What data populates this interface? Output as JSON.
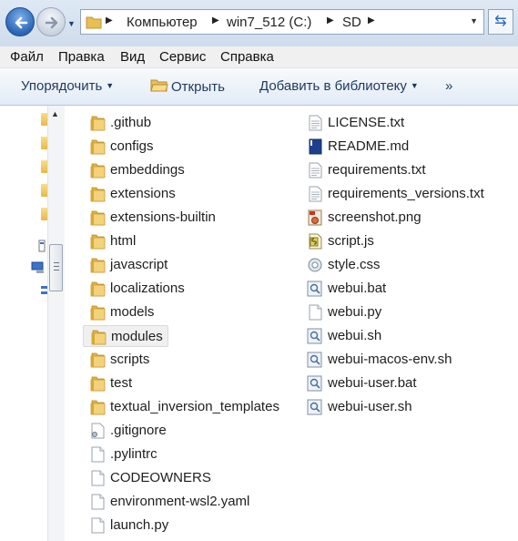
{
  "address": {
    "crumbs": [
      "Компьютер",
      "win7_512 (C:)",
      "SD"
    ]
  },
  "menu": [
    "Файл",
    "Правка",
    "Вид",
    "Сервис",
    "Справка"
  ],
  "toolbar": {
    "organize": "Упорядочить",
    "open": "Открыть",
    "add_to_library": "Добавить в библиотеку",
    "more": "»"
  },
  "files": {
    "col1": [
      {
        "name": ".github",
        "type": "folder"
      },
      {
        "name": "configs",
        "type": "folder"
      },
      {
        "name": "embeddings",
        "type": "folder"
      },
      {
        "name": "extensions",
        "type": "folder"
      },
      {
        "name": "extensions-builtin",
        "type": "folder"
      },
      {
        "name": "html",
        "type": "folder"
      },
      {
        "name": "javascript",
        "type": "folder"
      },
      {
        "name": "localizations",
        "type": "folder"
      },
      {
        "name": "models",
        "type": "folder"
      },
      {
        "name": "modules",
        "type": "folder",
        "selected": true
      },
      {
        "name": "scripts",
        "type": "folder"
      },
      {
        "name": "test",
        "type": "folder"
      },
      {
        "name": "textual_inversion_templates",
        "type": "folder"
      },
      {
        "name": ".gitignore",
        "type": "gear-file"
      },
      {
        "name": ".pylintrc",
        "type": "file"
      },
      {
        "name": "CODEOWNERS",
        "type": "file"
      },
      {
        "name": "environment-wsl2.yaml",
        "type": "file"
      },
      {
        "name": "launch.py",
        "type": "file"
      }
    ],
    "col2": [
      {
        "name": "LICENSE.txt",
        "type": "text"
      },
      {
        "name": "README.md",
        "type": "md"
      },
      {
        "name": "requirements.txt",
        "type": "text"
      },
      {
        "name": "requirements_versions.txt",
        "type": "text"
      },
      {
        "name": "screenshot.png",
        "type": "image"
      },
      {
        "name": "script.js",
        "type": "js"
      },
      {
        "name": "style.css",
        "type": "css"
      },
      {
        "name": "webui.bat",
        "type": "bat"
      },
      {
        "name": "webui.py",
        "type": "file"
      },
      {
        "name": "webui.sh",
        "type": "bat"
      },
      {
        "name": "webui-macos-env.sh",
        "type": "bat"
      },
      {
        "name": "webui-user.bat",
        "type": "bat"
      },
      {
        "name": "webui-user.sh",
        "type": "bat"
      }
    ]
  }
}
